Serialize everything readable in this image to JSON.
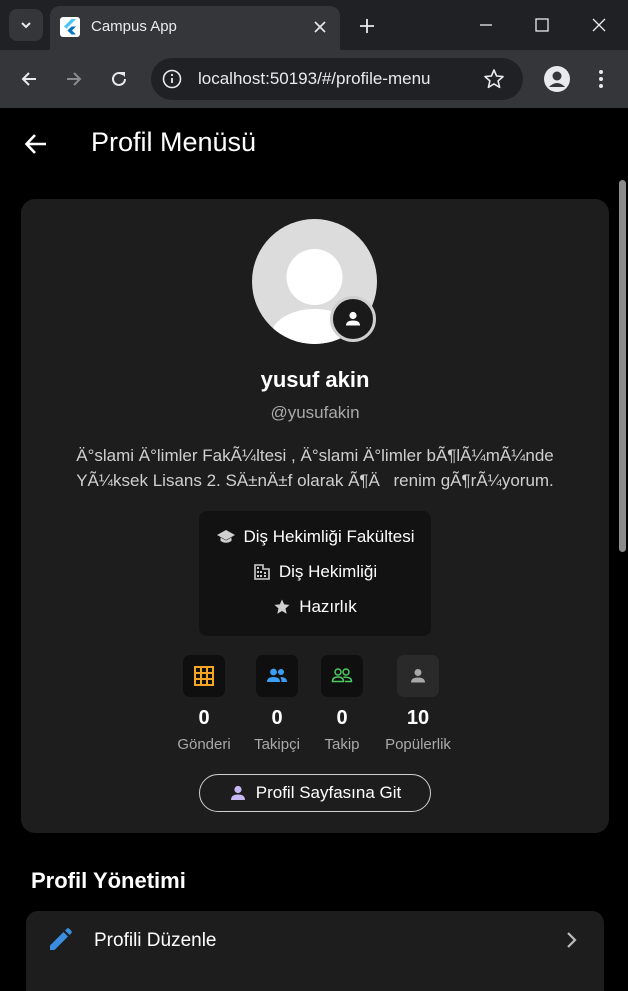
{
  "browser": {
    "tab_title": "Campus App",
    "url": "localhost:50193/#/profile-menu"
  },
  "appbar": {
    "title": "Profil Menüsü"
  },
  "profile": {
    "name": "yusuf akin",
    "handle": "@yusufakin",
    "bio": "Ä°slami Ä°limler FakÃ¼ltesi , Ä°slami Ä°limler bÃ¶lÃ¼mÃ¼nde YÃ¼ksek Lisans 2. SÄ±nÄ±f olarak Ã¶Ärenim gÃ¶rÃ¼yorum.",
    "faculty": "Diş Hekimliği Fakültesi",
    "department": "Diş Hekimliği",
    "level": "Hazırlık",
    "stats": [
      {
        "value": "0",
        "label": "Gönderi",
        "icon": "grid-icon",
        "color": "#f5a623"
      },
      {
        "value": "0",
        "label": "Takipçi",
        "icon": "people-icon",
        "color": "#3b9ff5"
      },
      {
        "value": "0",
        "label": "Takip",
        "icon": "people-outline-icon",
        "color": "#4cc960"
      },
      {
        "value": "10",
        "label": "Popülerlik",
        "icon": "person-icon",
        "color": "#a8a8a8"
      }
    ],
    "profile_page_button": "Profil Sayfasına Git"
  },
  "management": {
    "title": "Profil Yönetimi",
    "items": [
      {
        "label": "Profili Düzenle",
        "icon": "edit-icon"
      }
    ]
  },
  "colors": {
    "accent_purple": "#c7b8f5",
    "edit_blue": "#3b8de0"
  }
}
